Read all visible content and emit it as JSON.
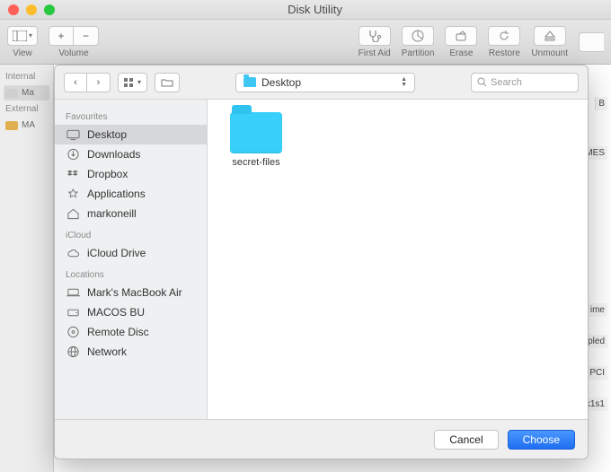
{
  "window": {
    "title": "Disk Utility"
  },
  "toolbar": {
    "view_label": "View",
    "volume_label": "Volume",
    "firstaid_label": "First Aid",
    "partition_label": "Partition",
    "erase_label": "Erase",
    "restore_label": "Restore",
    "unmount_label": "Unmount"
  },
  "main_sidebar": {
    "internal_hdr": "Internal",
    "internal_items": [
      "Ma"
    ],
    "external_hdr": "External",
    "external_items": [
      "MA"
    ]
  },
  "picker": {
    "location": "Desktop",
    "search_placeholder": "Search",
    "sections": {
      "favourites_hdr": "Favourites",
      "favourites": [
        "Desktop",
        "Downloads",
        "Dropbox",
        "Applications",
        "markoneill"
      ],
      "icloud_hdr": "iCloud",
      "icloud": [
        "iCloud Drive"
      ],
      "locations_hdr": "Locations",
      "locations": [
        "Mark's MacBook Air",
        "MACOS BU",
        "Remote Disc",
        "Network"
      ]
    },
    "items": [
      {
        "name": "secret-files",
        "type": "folder"
      }
    ],
    "cancel_label": "Cancel",
    "choose_label": "Choose"
  },
  "right_fragments": [
    "B",
    "JMES",
    "ime",
    "pled",
    "PCI",
    "k1s1"
  ]
}
